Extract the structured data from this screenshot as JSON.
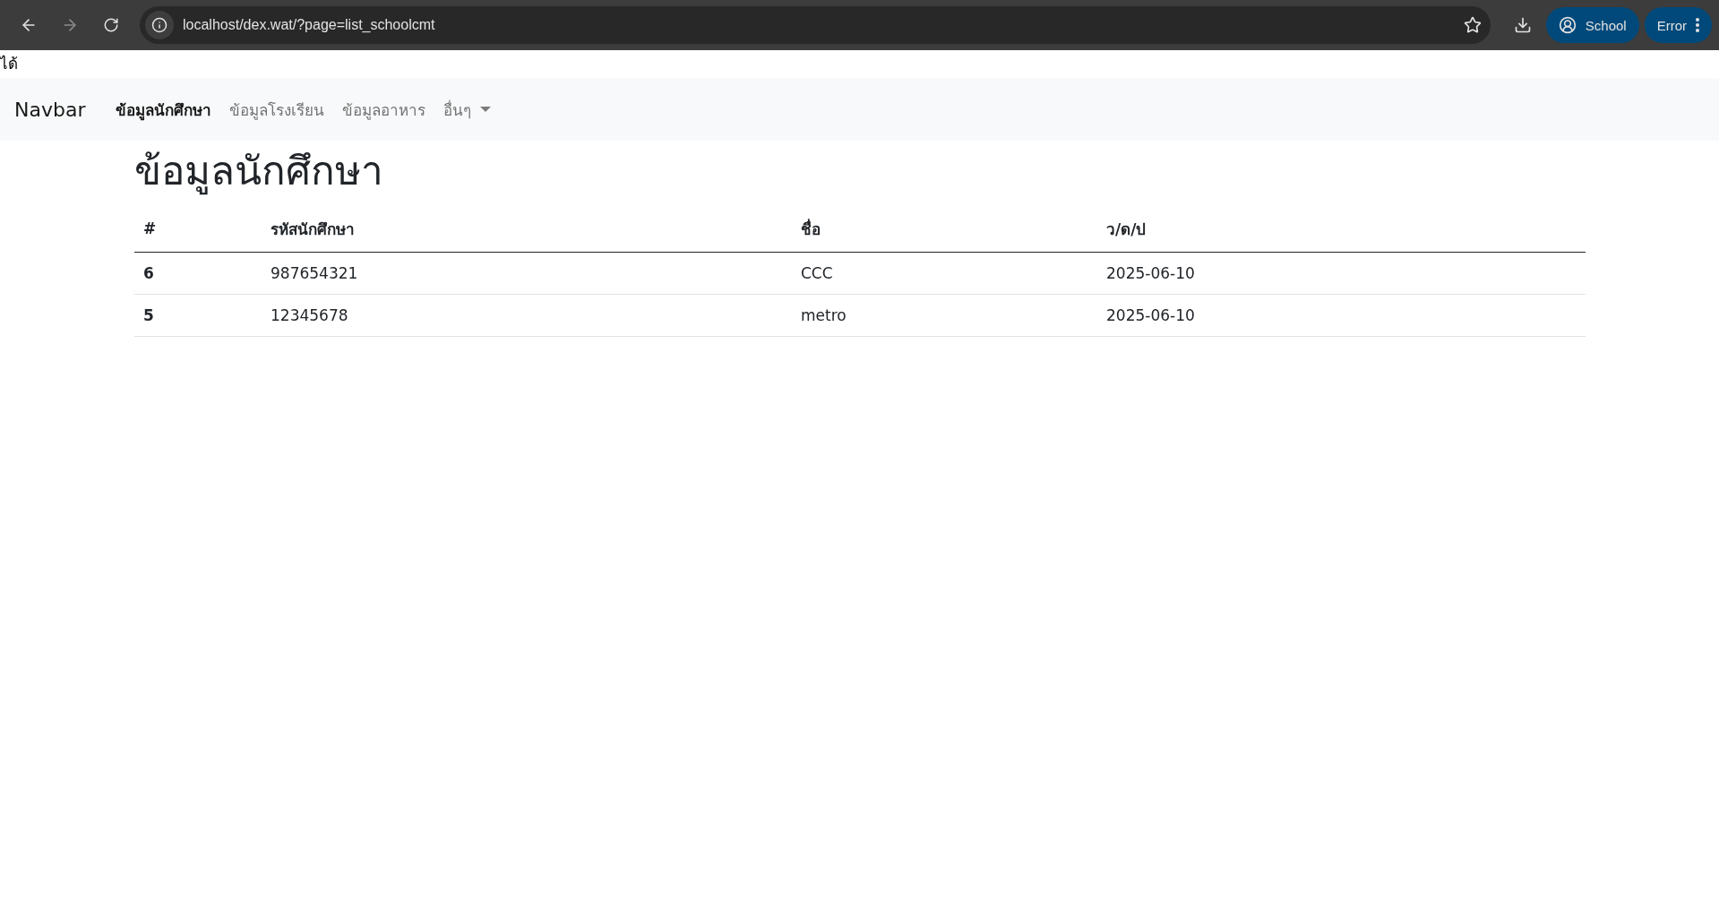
{
  "browser": {
    "url": "localhost/dex.wat/?page=list_schoolcmt",
    "profile": "School",
    "error_button": "Error"
  },
  "page_text": "ได้",
  "navbar": {
    "brand": "Navbar",
    "items": [
      {
        "label": "ข้อมูลนักศึกษา",
        "selected": true,
        "dropdown": false
      },
      {
        "label": "ข้อมูลโรงเรียน",
        "selected": false,
        "dropdown": false
      },
      {
        "label": "ข้อมูลอาหาร",
        "selected": false,
        "dropdown": false
      },
      {
        "label": "อื่นๆ",
        "selected": false,
        "dropdown": true
      }
    ]
  },
  "heading": "ข้อมูลนักศึกษา",
  "table": {
    "columns": [
      "#",
      "รหัสนักศึกษา",
      "ชื่อ",
      "ว/ด/ป"
    ],
    "rows": [
      [
        "6",
        "987654321",
        "CCC",
        "2025-06-10"
      ],
      [
        "5",
        "12345678",
        "metro",
        "2025-06-10"
      ]
    ]
  }
}
